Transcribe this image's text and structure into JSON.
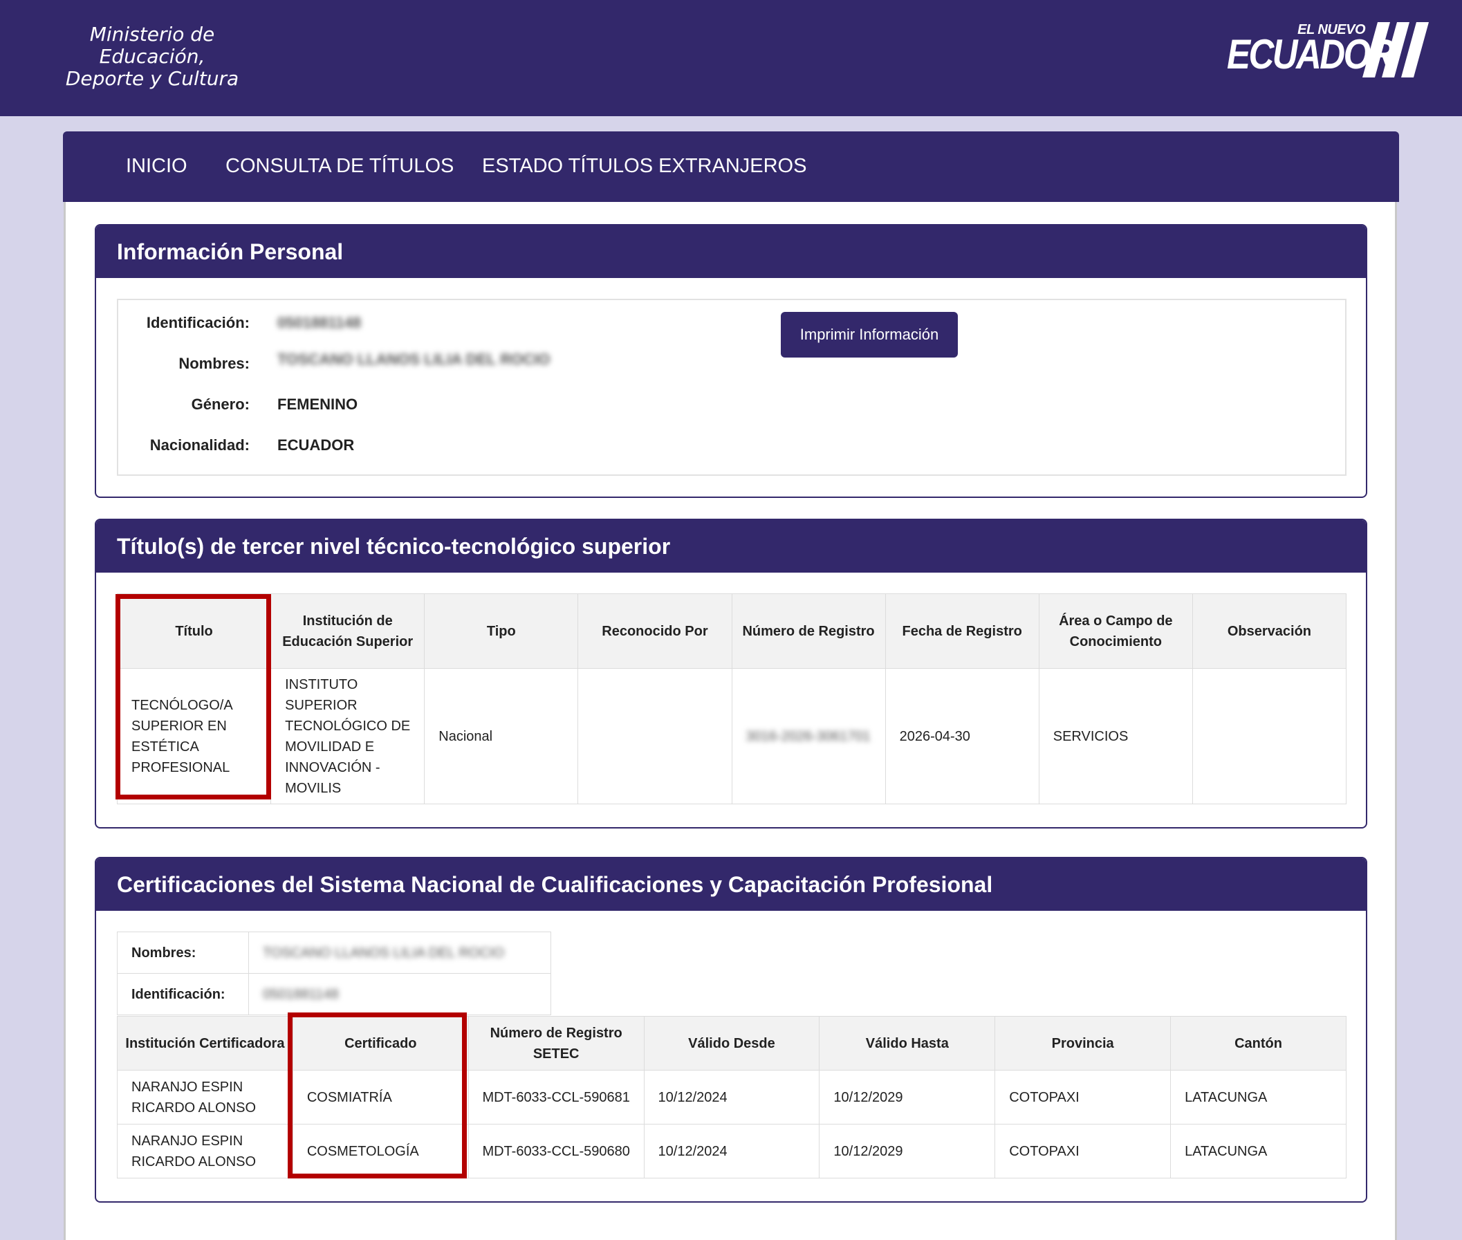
{
  "header": {
    "ministry_line1": "Ministerio de Educación,",
    "ministry_line2": "Deporte y Cultura",
    "logo_small": "EL NUEVO",
    "logo_big": "ECUADOR"
  },
  "nav": {
    "items": [
      {
        "label": "INICIO"
      },
      {
        "label": "CONSULTA DE TÍTULOS"
      },
      {
        "label": "ESTADO TÍTULOS EXTRANJEROS"
      }
    ]
  },
  "personal": {
    "title": "Información Personal",
    "print_button": "Imprimir Información",
    "fields": [
      {
        "label": "Identificación:",
        "value": "0501881148",
        "blurred": true
      },
      {
        "label": "Nombres:",
        "value": "TOSCANO LLANOS LILIA DEL ROCIO",
        "blurred": true
      },
      {
        "label": "Género:",
        "value": "FEMENINO",
        "blurred": false
      },
      {
        "label": "Nacionalidad:",
        "value": "ECUADOR",
        "blurred": false
      }
    ]
  },
  "titles": {
    "title": "Título(s) de tercer nivel técnico-tecnológico superior",
    "headers": [
      "Título",
      "Institución de Educación Superior",
      "Tipo",
      "Reconocido Por",
      "Número de Registro",
      "Fecha de Registro",
      "Área o Campo de Conocimiento",
      "Observación"
    ],
    "rows": [
      [
        "TECNÓLOGO/A SUPERIOR EN ESTÉTICA PROFESIONAL",
        "INSTITUTO SUPERIOR TECNOLÓGICO DE MOVILIDAD E INNOVACIÓN - MOVILIS",
        "Nacional",
        "",
        "3016-2026-3061701",
        "2026-04-30",
        "SERVICIOS",
        ""
      ]
    ]
  },
  "certs": {
    "title": "Certificaciones del Sistema Nacional de Cualificaciones y Capacitación Profesional",
    "name_label": "Nombres:",
    "name_value": "TOSCANO LLANOS LILIA DEL ROCIO",
    "id_label": "Identificación:",
    "id_value": "0501881148",
    "headers": [
      "Institución Certificadora",
      "Certificado",
      "Número de Registro SETEC",
      "Válido Desde",
      "Válido Hasta",
      "Provincia",
      "Cantón"
    ],
    "rows": [
      [
        "NARANJO ESPIN RICARDO ALONSO",
        "COSMIATRÍA",
        "MDT-6033-CCL-590681",
        "10/12/2024",
        "10/12/2029",
        "COTOPAXI",
        "LATACUNGA"
      ],
      [
        "NARANJO ESPIN RICARDO ALONSO",
        "COSMETOLOGÍA",
        "MDT-6033-CCL-590680",
        "10/12/2024",
        "10/12/2029",
        "COTOPAXI",
        "LATACUNGA"
      ]
    ]
  },
  "colors": {
    "primary": "#33286b",
    "background": "#d6d4ea",
    "highlight": "#b30000"
  }
}
